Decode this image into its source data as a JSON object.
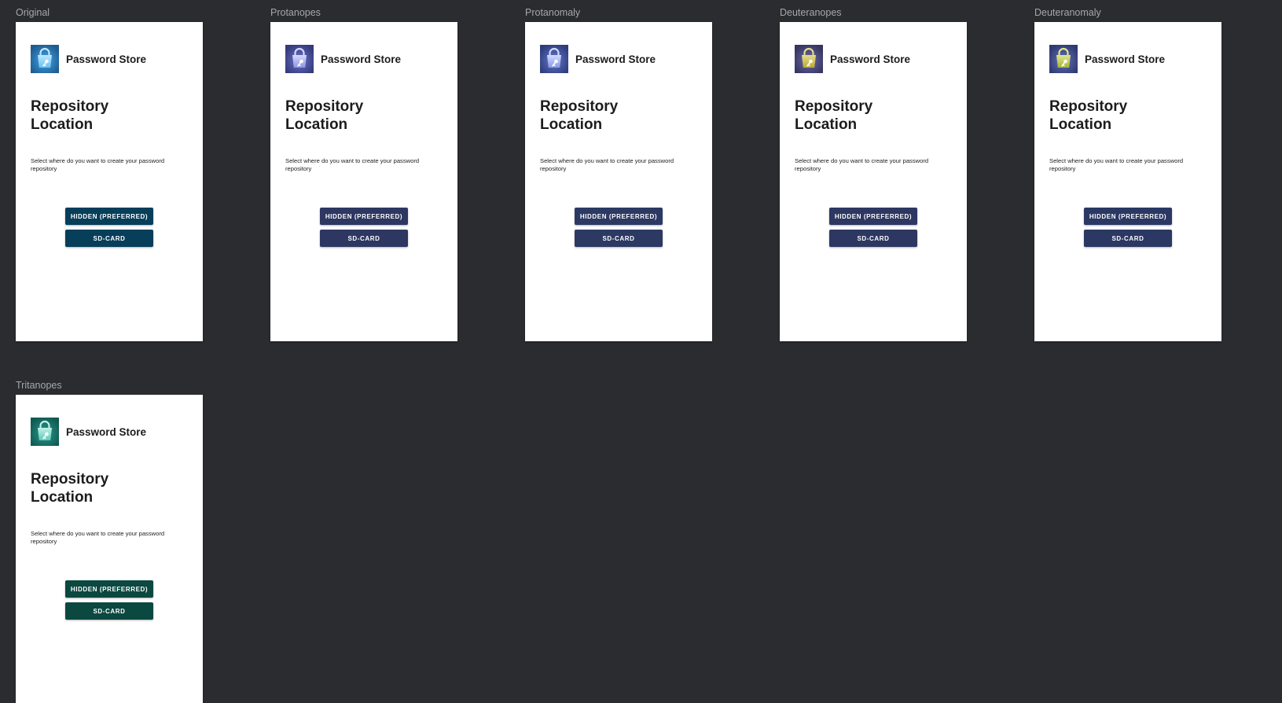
{
  "frames": [
    {
      "label": "Original",
      "app_title": "Password Store",
      "heading_line1": "Repository",
      "heading_line2": "Location",
      "description": "Select where do you want to create your password repository",
      "hidden_button": "HIDDEN (PREFERRED)",
      "sdcard_button": "SD-CARD",
      "colors": {
        "button": "#073e5a",
        "logo_bg": "#1f5b8f",
        "logo_glow": "#3fa7e8",
        "bag": "#69c1f2",
        "bag_light": "#bfe7ff"
      }
    },
    {
      "label": "Protanopes",
      "app_title": "Password Store",
      "heading_line1": "Repository",
      "heading_line2": "Location",
      "description": "Select where do you want to create your password repository",
      "hidden_button": "HIDDEN (PREFERRED)",
      "sdcard_button": "SD-CARD",
      "colors": {
        "button": "#2d3761",
        "logo_bg": "#343a7a",
        "logo_glow": "#6c73c9",
        "bag": "#8e93e6",
        "bag_light": "#d5d8ff"
      }
    },
    {
      "label": "Protanomaly",
      "app_title": "Password Store",
      "heading_line1": "Repository",
      "heading_line2": "Location",
      "description": "Select where do you want to create your password repository",
      "hidden_button": "HIDDEN (PREFERRED)",
      "sdcard_button": "SD-CARD",
      "colors": {
        "button": "#2c3963",
        "logo_bg": "#2f3d7c",
        "logo_glow": "#6579cc",
        "bag": "#8a98e8",
        "bag_light": "#d2daff"
      }
    },
    {
      "label": "Deuteranopes",
      "app_title": "Password Store",
      "heading_line1": "Repository",
      "heading_line2": "Location",
      "description": "Select where do you want to create your password repository",
      "hidden_button": "HIDDEN (PREFERRED)",
      "sdcard_button": "SD-CARD",
      "colors": {
        "button": "#2d3761",
        "logo_bg": "#353560",
        "logo_glow": "#6e6aa4",
        "bag": "#b9a93a",
        "bag_light": "#e6dc8a"
      }
    },
    {
      "label": "Deuteranomaly",
      "app_title": "Password Store",
      "heading_line1": "Repository",
      "heading_line2": "Location",
      "description": "Select where do you want to create your password repository",
      "hidden_button": "HIDDEN (PREFERRED)",
      "sdcard_button": "SD-CARD",
      "colors": {
        "button": "#2b3863",
        "logo_bg": "#2f3a72",
        "logo_glow": "#6570b8",
        "bag": "#a6b43c",
        "bag_light": "#dfe68e"
      }
    },
    {
      "label": "Tritanopes",
      "app_title": "Password Store",
      "heading_line1": "Repository",
      "heading_line2": "Location",
      "description": "Select where do you want to create your password repository",
      "hidden_button": "HIDDEN (PREFERRED)",
      "sdcard_button": "SD-CARD",
      "colors": {
        "button": "#0b4840",
        "logo_bg": "#0f5a52",
        "logo_glow": "#2a9a8c",
        "bag": "#5cc9b8",
        "bag_light": "#c0f1e8"
      }
    }
  ]
}
